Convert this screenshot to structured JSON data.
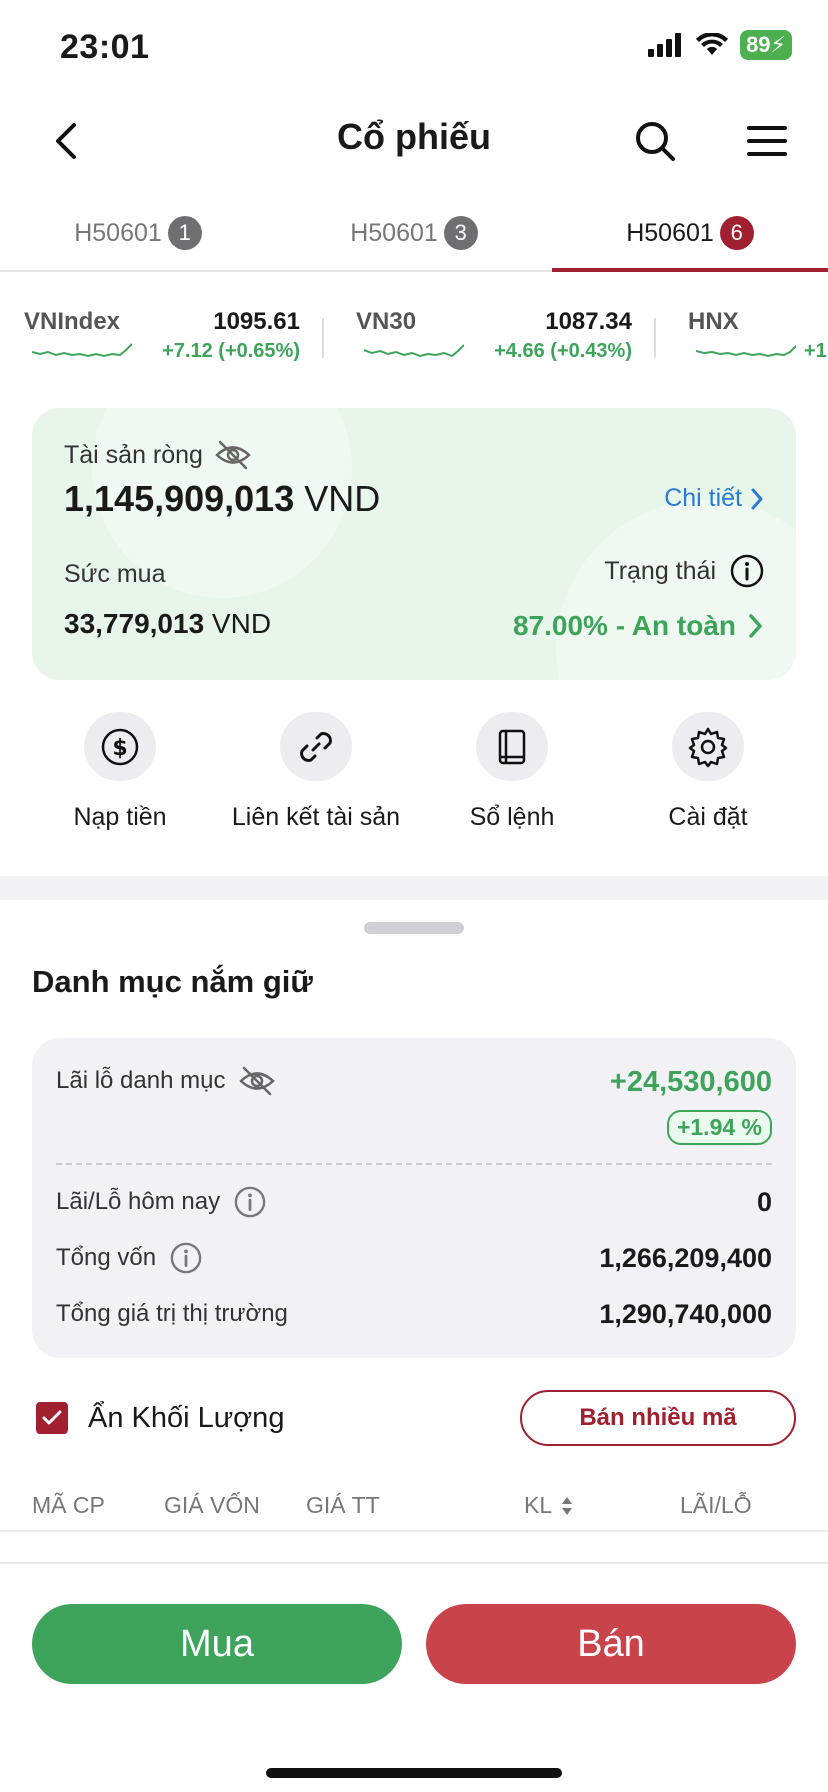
{
  "status_bar": {
    "time": "23:01",
    "battery": "89"
  },
  "header": {
    "title": "Cổ phiếu"
  },
  "account_tabs": [
    {
      "label": "H50601",
      "badge": "1"
    },
    {
      "label": "H50601",
      "badge": "3"
    },
    {
      "label": "H50601",
      "badge": "6"
    }
  ],
  "tickers": [
    {
      "name": "VNIndex",
      "value": "1095.61",
      "change": "+7.12 (+0.65%)"
    },
    {
      "name": "VN30",
      "value": "1087.34",
      "change": "+4.66 (+0.43%)"
    },
    {
      "name": "HNX",
      "value": "",
      "change": "+1"
    }
  ],
  "asset_card": {
    "net_label": "Tài sản ròng",
    "net_value": "1,145,909,013",
    "net_unit": "VND",
    "detail_link": "Chi tiết",
    "buy_power_label": "Sức mua",
    "buy_power_value": "33,779,013",
    "buy_power_unit": "VND",
    "status_label": "Trạng thái",
    "status_value": "87.00% - An toàn"
  },
  "quick_actions": [
    {
      "label": "Nạp tiền",
      "icon": "dollar-icon"
    },
    {
      "label": "Liên kết tài sản",
      "icon": "link-icon"
    },
    {
      "label": "Sổ lệnh",
      "icon": "book-icon"
    },
    {
      "label": "Cài đặt",
      "icon": "gear-icon"
    }
  ],
  "portfolio": {
    "title": "Danh mục nắm giữ",
    "pnl_label": "Lãi lỗ danh mục",
    "pnl_value": "+24,530,600",
    "pnl_pct": "+1.94 %",
    "today_label": "Lãi/Lỗ hôm nay",
    "today_value": "0",
    "capital_label": "Tổng vốn",
    "capital_value": "1,266,209,400",
    "market_label": "Tổng giá trị thị trường",
    "market_value": "1,290,740,000"
  },
  "hide_volume": {
    "label": "Ẩn Khối Lượng",
    "checked": true
  },
  "sell_multi_label": "Bán nhiều mã",
  "columns": [
    "MÃ CP",
    "GIÁ VỐN",
    "GIÁ TT",
    "KL",
    "LÃI/LỖ"
  ],
  "actions": {
    "buy": "Mua",
    "sell": "Bán"
  },
  "colors": {
    "accent": "#a0202f",
    "positive": "#3da45a",
    "buy": "#3ea35b",
    "sell": "#c8434a",
    "link": "#2a7bd3"
  }
}
